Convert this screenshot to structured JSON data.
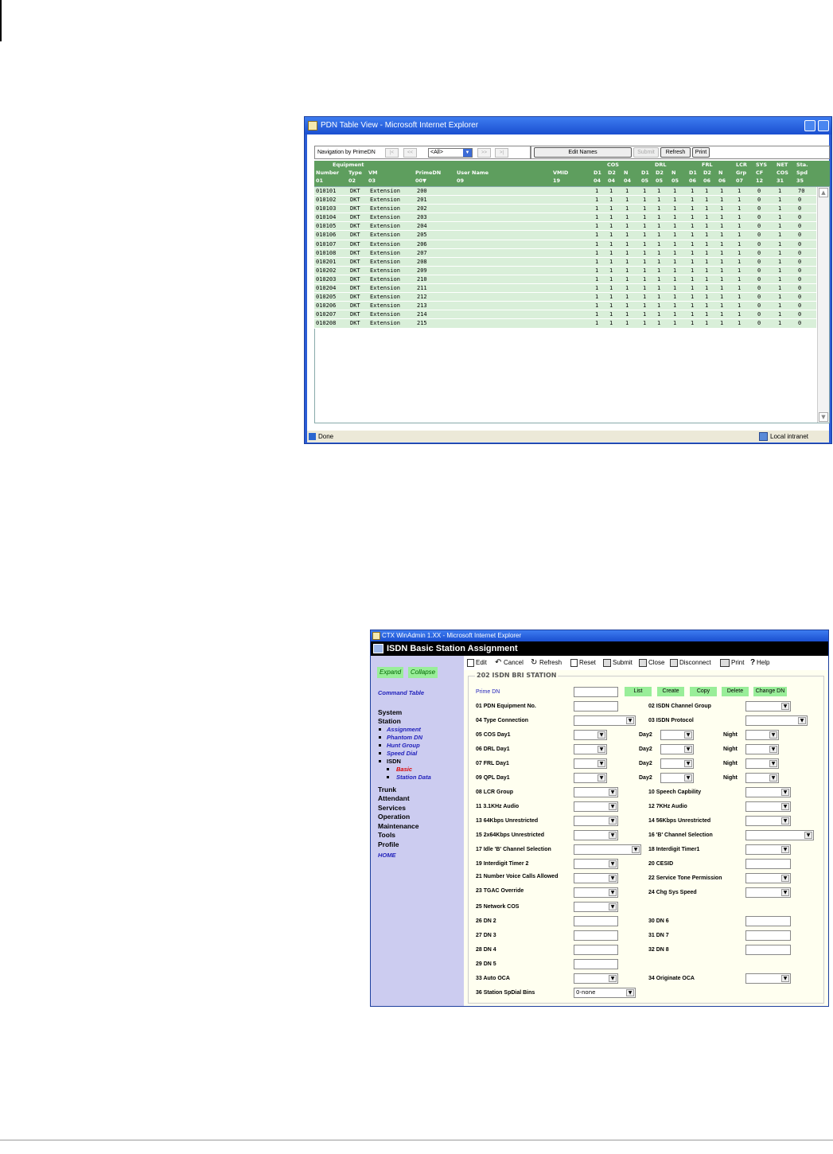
{
  "pdn_window": {
    "title": "PDN Table View - Microsoft Internet Explorer",
    "nav_label": "Navigation by PrimeDN",
    "nav_first": "|<",
    "nav_prev": "<<",
    "nav_select": "<All>",
    "nav_next": ">>",
    "nav_last": ">|",
    "edit_names": "Edit Names",
    "submit": "Submit",
    "refresh": "Refresh",
    "print": "Print",
    "headers": {
      "equipment": "Equipment",
      "number": "Number",
      "number_id": "01",
      "type": "Type",
      "type_id": "02",
      "vm": "VM",
      "vm_id": "03",
      "primedn": "PrimeDN",
      "primedn_id": "00▼",
      "username": "User Name",
      "username_id": "09",
      "vmid": "VMID",
      "vmid_id": "19",
      "cos": "COS",
      "cos_d1": "D1",
      "cos_d2": "D2",
      "cos_n": "N",
      "cos_d1_id": "04",
      "cos_d2_id": "04",
      "cos_n_id": "04",
      "drl": "DRL",
      "drl_d1": "D1",
      "drl_d2": "D2",
      "drl_n": "N",
      "drl_d1_id": "05",
      "drl_d2_id": "05",
      "drl_n_id": "05",
      "frl": "FRL",
      "frl_d1": "D1",
      "frl_d2": "D2",
      "frl_n": "N",
      "frl_d1_id": "06",
      "frl_d2_id": "06",
      "frl_n_id": "06",
      "lcr": "LCR",
      "lcr_grp": "Grp",
      "lcr_id": "07",
      "sys": "SYS",
      "sys_cf": "CF",
      "sys_id": "12",
      "net": "NET",
      "net_cos": "COS",
      "net_id": "31",
      "sta": "Sta.",
      "sta_spd": "Spd",
      "sta_id": "35"
    },
    "rows": [
      {
        "num": "010101",
        "type": "DKT",
        "vm": "Extension",
        "dn": "200",
        "vals": [
          "1",
          "1",
          "1",
          "1",
          "1",
          "1",
          "1",
          "1",
          "1",
          "1",
          "0",
          "1",
          "70"
        ]
      },
      {
        "num": "010102",
        "type": "DKT",
        "vm": "Extension",
        "dn": "201",
        "vals": [
          "1",
          "1",
          "1",
          "1",
          "1",
          "1",
          "1",
          "1",
          "1",
          "1",
          "0",
          "1",
          "0"
        ]
      },
      {
        "num": "010103",
        "type": "DKT",
        "vm": "Extension",
        "dn": "202",
        "vals": [
          "1",
          "1",
          "1",
          "1",
          "1",
          "1",
          "1",
          "1",
          "1",
          "1",
          "0",
          "1",
          "0"
        ]
      },
      {
        "num": "010104",
        "type": "DKT",
        "vm": "Extension",
        "dn": "203",
        "vals": [
          "1",
          "1",
          "1",
          "1",
          "1",
          "1",
          "1",
          "1",
          "1",
          "1",
          "0",
          "1",
          "0"
        ]
      },
      {
        "num": "010105",
        "type": "DKT",
        "vm": "Extension",
        "dn": "204",
        "vals": [
          "1",
          "1",
          "1",
          "1",
          "1",
          "1",
          "1",
          "1",
          "1",
          "1",
          "0",
          "1",
          "0"
        ]
      },
      {
        "num": "010106",
        "type": "DKT",
        "vm": "Extension",
        "dn": "205",
        "vals": [
          "1",
          "1",
          "1",
          "1",
          "1",
          "1",
          "1",
          "1",
          "1",
          "1",
          "0",
          "1",
          "0"
        ]
      },
      {
        "num": "010107",
        "type": "DKT",
        "vm": "Extension",
        "dn": "206",
        "vals": [
          "1",
          "1",
          "1",
          "1",
          "1",
          "1",
          "1",
          "1",
          "1",
          "1",
          "0",
          "1",
          "0"
        ]
      },
      {
        "num": "010108",
        "type": "DKT",
        "vm": "Extension",
        "dn": "207",
        "vals": [
          "1",
          "1",
          "1",
          "1",
          "1",
          "1",
          "1",
          "1",
          "1",
          "1",
          "0",
          "1",
          "0"
        ]
      },
      {
        "num": "010201",
        "type": "DKT",
        "vm": "Extension",
        "dn": "208",
        "vals": [
          "1",
          "1",
          "1",
          "1",
          "1",
          "1",
          "1",
          "1",
          "1",
          "1",
          "0",
          "1",
          "0"
        ]
      },
      {
        "num": "010202",
        "type": "DKT",
        "vm": "Extension",
        "dn": "209",
        "vals": [
          "1",
          "1",
          "1",
          "1",
          "1",
          "1",
          "1",
          "1",
          "1",
          "1",
          "0",
          "1",
          "0"
        ]
      },
      {
        "num": "010203",
        "type": "DKT",
        "vm": "Extension",
        "dn": "210",
        "vals": [
          "1",
          "1",
          "1",
          "1",
          "1",
          "1",
          "1",
          "1",
          "1",
          "1",
          "0",
          "1",
          "0"
        ]
      },
      {
        "num": "010204",
        "type": "DKT",
        "vm": "Extension",
        "dn": "211",
        "vals": [
          "1",
          "1",
          "1",
          "1",
          "1",
          "1",
          "1",
          "1",
          "1",
          "1",
          "0",
          "1",
          "0"
        ]
      },
      {
        "num": "010205",
        "type": "DKT",
        "vm": "Extension",
        "dn": "212",
        "vals": [
          "1",
          "1",
          "1",
          "1",
          "1",
          "1",
          "1",
          "1",
          "1",
          "1",
          "0",
          "1",
          "0"
        ]
      },
      {
        "num": "010206",
        "type": "DKT",
        "vm": "Extension",
        "dn": "213",
        "vals": [
          "1",
          "1",
          "1",
          "1",
          "1",
          "1",
          "1",
          "1",
          "1",
          "1",
          "0",
          "1",
          "0"
        ]
      },
      {
        "num": "010207",
        "type": "DKT",
        "vm": "Extension",
        "dn": "214",
        "vals": [
          "1",
          "1",
          "1",
          "1",
          "1",
          "1",
          "1",
          "1",
          "1",
          "1",
          "0",
          "1",
          "0"
        ]
      },
      {
        "num": "010208",
        "type": "DKT",
        "vm": "Extension",
        "dn": "215",
        "vals": [
          "1",
          "1",
          "1",
          "1",
          "1",
          "1",
          "1",
          "1",
          "1",
          "1",
          "0",
          "1",
          "0"
        ]
      }
    ],
    "status_done": "Done",
    "status_zone": "Local intranet"
  },
  "isdn_window": {
    "title": "CTX WinAdmin 1.XX - Microsoft Internet Explorer",
    "page_title": "ISDN Basic Station Assignment",
    "sidebar": {
      "expand": "Expand",
      "collapse": "Collapse",
      "command_table": "Command Table",
      "system": "System",
      "station": "Station",
      "assignment": "Assignment",
      "phantom_dn": "Phantom DN",
      "hunt_group": "Hunt Group",
      "speed_dial": "Speed Dial",
      "isdn": "ISDN",
      "basic": "Basic",
      "station_data": "Station Data",
      "trunk": "Trunk",
      "attendant": "Attendant",
      "services": "Services",
      "operation": "Operation",
      "maintenance": "Maintenance",
      "tools": "Tools",
      "profile": "Profile",
      "home": "HOME"
    },
    "toolbar": {
      "edit": "Edit",
      "cancel": "Cancel",
      "refresh": "Refresh",
      "reset": "Reset",
      "submit": "Submit",
      "close": "Close",
      "disconnect": "Disconnect",
      "print": "Print",
      "help": "Help"
    },
    "form": {
      "legend": "202 ISDN BRI STATION",
      "prime_dn": "Prime DN",
      "list": "List",
      "create": "Create",
      "copy": "Copy",
      "delete": "Delete",
      "change_dn": "Change DN",
      "f01": "01 PDN Equipment No.",
      "f02": "02 ISDN Channel Group",
      "f04": "04 Type Connection",
      "f03": "03 ISDN Protocol",
      "f05": "05 COS Day1",
      "f06": "06 DRL Day1",
      "f07": "07 FRL Day1",
      "f09": "09 QPL Day1",
      "day2": "Day2",
      "night": "Night",
      "f08": "08 LCR Group",
      "f10": "10 Speech Capbility",
      "f11": "11 3.1KHz Audio",
      "f12": "12 7KHz Audio",
      "f13": "13 64Kbps Unrestricted",
      "f14": "14 56Kbps Unrestricted",
      "f15": "15 2x64Kbps Unrestricted",
      "f16": "16 'B' Channel Selection",
      "f17": "17 Idle 'B' Channel Selection",
      "f18": "18 Interdigit Timer1",
      "f19": "19 Interdigit Timer 2",
      "f20": "20 CESID",
      "f21": "21 Number Voice Calls Allowed",
      "f22": "22 Service Tone Permission",
      "f23": "23 TGAC Override",
      "f24": "24 Chg Sys Speed",
      "f25": "25 Network COS",
      "f26": "26 DN 2",
      "f30": "30 DN 6",
      "f27": "27 DN 3",
      "f31": "31 DN 7",
      "f28": "28 DN 4",
      "f32": "32 DN 8",
      "f29": "29 DN 5",
      "f33": "33 Auto OCA",
      "f34": "34 Originate OCA",
      "f36": "36 Station SpDial Bins",
      "f36_value": "0-none"
    }
  }
}
